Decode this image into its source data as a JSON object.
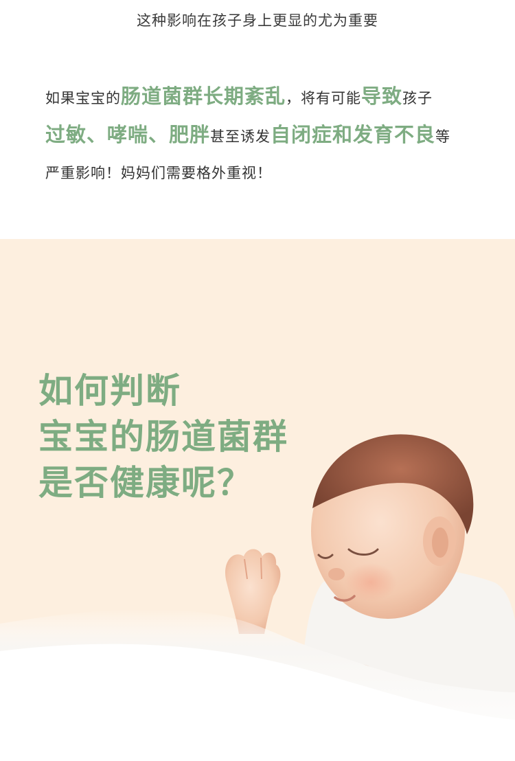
{
  "top": {
    "subtitle": "这种影响在孩子身上更显的尤为重要",
    "line1": {
      "t1": "如果宝宝的",
      "h1": "肠道菌群长期紊乱",
      "t2": "，将有可能",
      "h2": "导致",
      "t3": "孩子"
    },
    "line2": {
      "h1": "过敏、哮喘、肥胖",
      "t1": "甚至诱发",
      "h2": "自闭症和发育不良",
      "t2": "等"
    },
    "line3": {
      "t1": "严重影响！妈妈们需要格外重视！"
    }
  },
  "bottom": {
    "headline": [
      "如何判断",
      "宝宝的肠道菌群",
      "是否健康呢？"
    ],
    "image": "sleeping-baby-under-white-blanket"
  },
  "colors": {
    "accent_green": "#7eac82",
    "cream_background": "#fdefdf",
    "text_dark": "#333333"
  }
}
